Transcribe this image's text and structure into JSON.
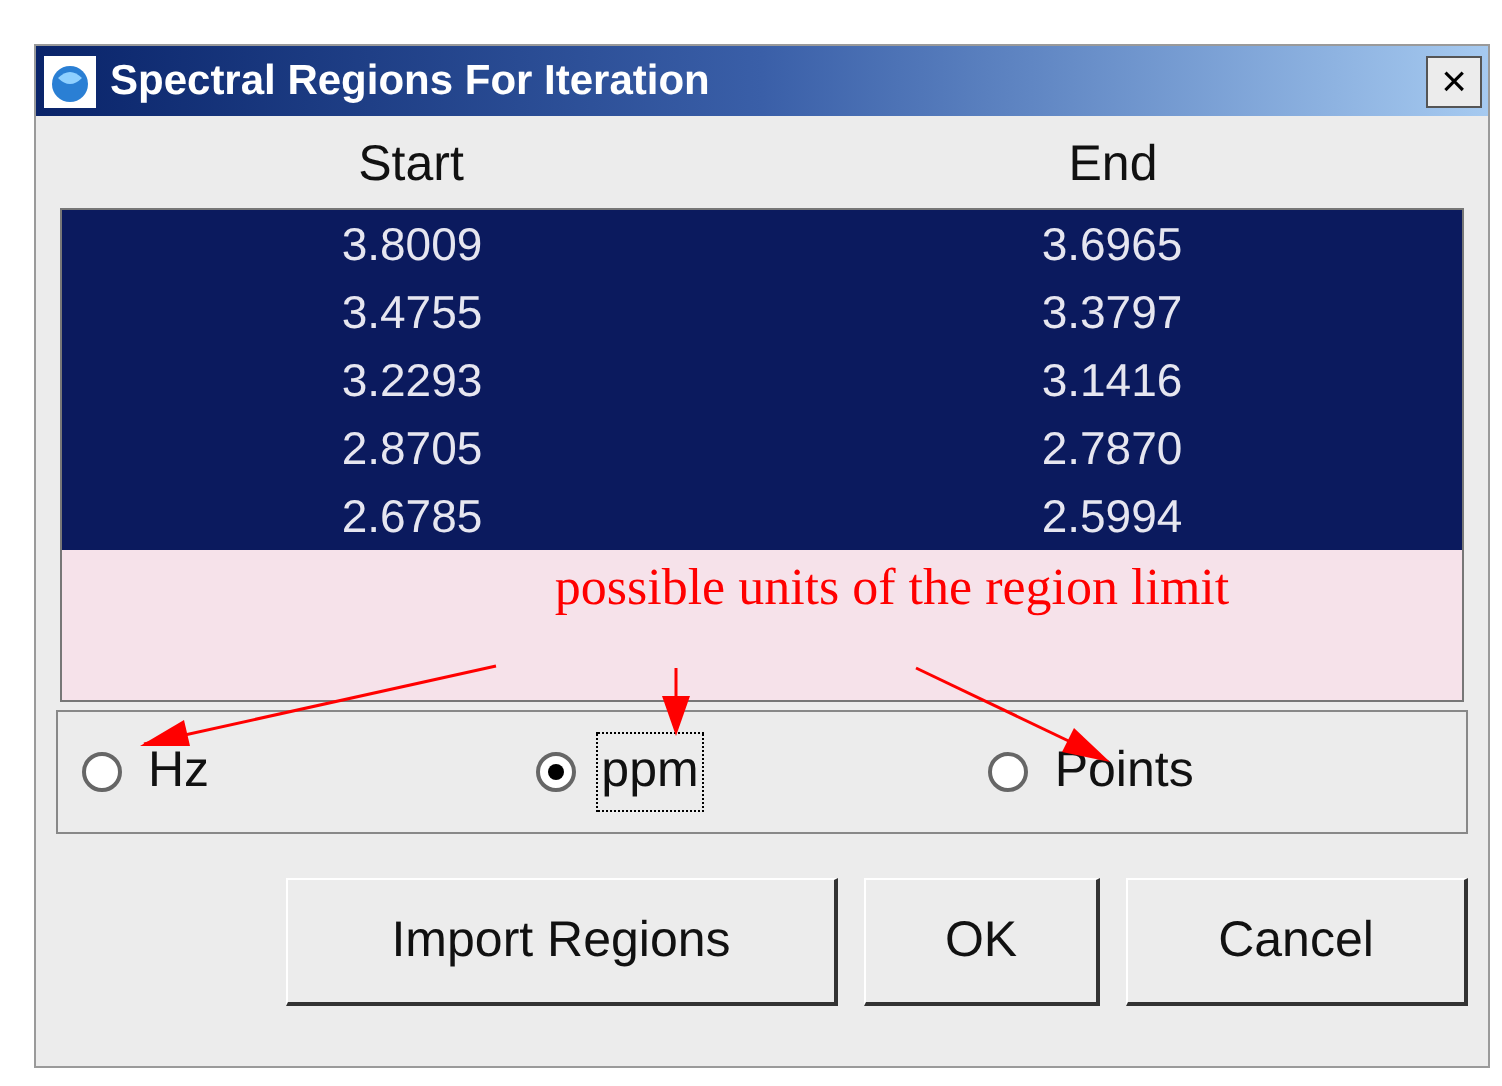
{
  "window": {
    "title": "Spectral Regions For Iteration",
    "close": "×"
  },
  "table": {
    "columns": [
      "Start",
      "End"
    ],
    "rows": [
      {
        "cells": [
          "3.8009",
          "3.6965"
        ],
        "selected": true
      },
      {
        "cells": [
          "3.4755",
          "3.3797"
        ],
        "selected": true
      },
      {
        "cells": [
          "3.2293",
          "3.1416"
        ],
        "selected": true
      },
      {
        "cells": [
          "2.8705",
          "2.7870"
        ],
        "selected": true
      },
      {
        "cells": [
          "2.6785",
          "2.5994"
        ],
        "selected": true
      }
    ]
  },
  "annotation": "possible units of the region limit",
  "units": [
    {
      "label": "Hz",
      "selected": false
    },
    {
      "label": "ppm",
      "selected": true
    },
    {
      "label": "Points",
      "selected": false
    }
  ],
  "buttons": [
    "Import Regions",
    "OK",
    "Cancel"
  ]
}
